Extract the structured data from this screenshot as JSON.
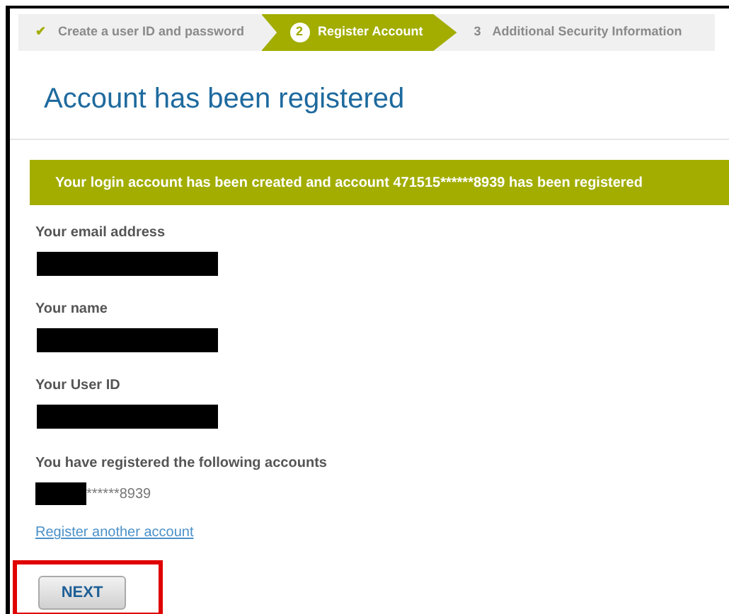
{
  "steps": [
    {
      "kind": "done",
      "marker": "✔",
      "label": "Create a user ID and password"
    },
    {
      "kind": "current",
      "marker": "2",
      "label": "Register Account"
    },
    {
      "kind": "upcoming",
      "marker": "3",
      "label": "Additional Security Information"
    }
  ],
  "title": "Account has been registered",
  "banner": "Your login account has been created and account 471515******8939 has been registered",
  "fields": [
    {
      "label": "Your email address"
    },
    {
      "label": "Your name"
    },
    {
      "label": "Your User ID"
    }
  ],
  "accounts": {
    "label": "You have registered the following accounts",
    "value": "******8939"
  },
  "link": "Register another account",
  "next_button": {
    "label": "NEXT",
    "highlighted": true
  }
}
